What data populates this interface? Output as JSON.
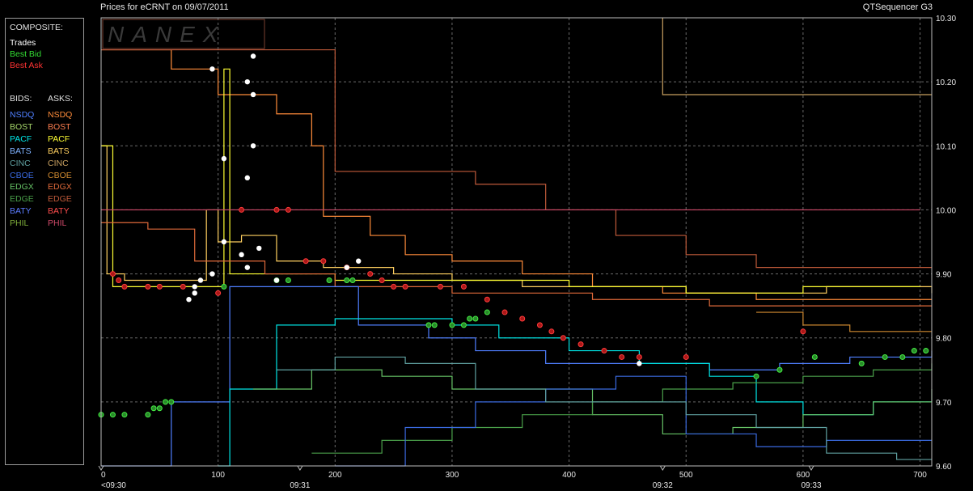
{
  "header": {
    "title": "Prices for  eCRNT  on  09/07/2011",
    "brand": "QTSequencer G3"
  },
  "watermark": "NANEX",
  "legend": {
    "composite_label": "COMPOSITE:",
    "composite": [
      {
        "label": "Trades",
        "color": "#ffffff"
      },
      {
        "label": "Best Bid",
        "color": "#33dd33"
      },
      {
        "label": "Best Ask",
        "color": "#ff3333"
      }
    ],
    "bids_label": "BIDS:",
    "asks_label": "ASKS:",
    "exchanges": [
      {
        "bid": "NSDQ",
        "ask": "NSDQ",
        "bid_color": "#4f7fff",
        "ask_color": "#ff8c3a"
      },
      {
        "bid": "BOST",
        "ask": "BOST",
        "bid_color": "#a7d86b",
        "ask_color": "#ff7f50"
      },
      {
        "bid": "PACF",
        "ask": "PACF",
        "bid_color": "#00e5e5",
        "ask_color": "#ffff33"
      },
      {
        "bid": "BATS",
        "ask": "BATS",
        "bid_color": "#7fb2ff",
        "ask_color": "#ffd060"
      },
      {
        "bid": "CINC",
        "ask": "CINC",
        "bid_color": "#5fa0a0",
        "ask_color": "#c8a060"
      },
      {
        "bid": "CBOE",
        "ask": "CBOE",
        "bid_color": "#3a6ae0",
        "ask_color": "#d08a30"
      },
      {
        "bid": "EDGX",
        "ask": "EDGX",
        "bid_color": "#66c266",
        "ask_color": "#e06a3a"
      },
      {
        "bid": "EDGE",
        "ask": "EDGE",
        "bid_color": "#4aa04a",
        "ask_color": "#c05a3a"
      },
      {
        "bid": "BATY",
        "ask": "BATY",
        "bid_color": "#5b7cff",
        "ask_color": "#ff4d4d"
      },
      {
        "bid": "PHIL",
        "ask": "PHIL",
        "bid_color": "#7fae3a",
        "ask_color": "#d04a6a"
      }
    ]
  },
  "chart_data": {
    "type": "line",
    "x_ticks": [
      0,
      100,
      200,
      300,
      400,
      500,
      600,
      700
    ],
    "x_time_labels": [
      {
        "x": 0,
        "label": "<09:30"
      },
      {
        "x": 170,
        "label": "09:31"
      },
      {
        "x": 480,
        "label": "09:32"
      },
      {
        "x": 607,
        "label": "09:33"
      }
    ],
    "xlim": [
      0,
      710
    ],
    "y_ticks": [
      "10.30",
      "10.20",
      "10.10",
      "10.00",
      "9.90",
      "9.80",
      "9.70",
      "9.60"
    ],
    "ylim": [
      9.6,
      10.3
    ],
    "grid": true,
    "series": [
      {
        "color": "#ff8c3a",
        "points": [
          [
            0,
            10.25
          ],
          [
            40,
            10.25
          ],
          [
            60,
            10.22
          ],
          [
            100,
            10.18
          ],
          [
            150,
            10.15
          ],
          [
            180,
            10.1
          ],
          [
            190,
            9.99
          ],
          [
            230,
            9.96
          ],
          [
            260,
            9.93
          ],
          [
            300,
            9.92
          ],
          [
            360,
            9.9
          ],
          [
            420,
            9.88
          ],
          [
            480,
            9.87
          ],
          [
            560,
            9.86
          ],
          [
            640,
            9.86
          ],
          [
            710,
            9.86
          ]
        ]
      },
      {
        "color": "#ffd060",
        "points": [
          [
            0,
            10.1
          ],
          [
            5,
            9.9
          ],
          [
            20,
            9.89
          ],
          [
            60,
            9.89
          ],
          [
            90,
            10.0
          ],
          [
            100,
            9.95
          ],
          [
            120,
            9.96
          ],
          [
            150,
            9.92
          ],
          [
            190,
            9.91
          ],
          [
            250,
            9.9
          ],
          [
            300,
            9.89
          ],
          [
            360,
            9.88
          ],
          [
            400,
            9.88
          ],
          [
            440,
            9.88
          ],
          [
            500,
            9.87
          ],
          [
            560,
            9.87
          ],
          [
            620,
            9.88
          ],
          [
            680,
            9.88
          ],
          [
            710,
            9.87
          ]
        ]
      },
      {
        "color": "#ffff33",
        "points": [
          [
            0,
            10.1
          ],
          [
            10,
            9.88
          ],
          [
            100,
            9.88
          ],
          [
            105,
            10.22
          ],
          [
            110,
            9.9
          ],
          [
            200,
            9.89
          ],
          [
            300,
            9.89
          ],
          [
            400,
            9.88
          ],
          [
            500,
            9.87
          ],
          [
            600,
            9.88
          ],
          [
            700,
            9.88
          ]
        ]
      },
      {
        "color": "#c05a3a",
        "points": [
          [
            0,
            10.25
          ],
          [
            200,
            10.25
          ],
          [
            200,
            10.06
          ],
          [
            270,
            10.06
          ],
          [
            320,
            10.04
          ],
          [
            380,
            10.0
          ],
          [
            440,
            9.96
          ],
          [
            500,
            9.93
          ],
          [
            560,
            9.91
          ],
          [
            640,
            9.91
          ],
          [
            710,
            9.91
          ]
        ]
      },
      {
        "color": "#d04a6a",
        "points": [
          [
            0,
            10.0
          ],
          [
            300,
            10.0
          ],
          [
            500,
            10.0
          ],
          [
            700,
            10.0
          ]
        ]
      },
      {
        "color": "#e06a3a",
        "points": [
          [
            0,
            9.98
          ],
          [
            40,
            9.97
          ],
          [
            80,
            9.92
          ],
          [
            140,
            9.9
          ],
          [
            200,
            9.88
          ],
          [
            300,
            9.87
          ],
          [
            420,
            9.86
          ],
          [
            520,
            9.85
          ],
          [
            620,
            9.85
          ],
          [
            710,
            9.85
          ]
        ]
      },
      {
        "color": "#c8a060",
        "points": [
          [
            480,
            10.3
          ],
          [
            480,
            10.18
          ],
          [
            710,
            10.18
          ]
        ]
      },
      {
        "color": "#d08a30",
        "points": [
          [
            560,
            9.84
          ],
          [
            600,
            9.82
          ],
          [
            640,
            9.81
          ],
          [
            710,
            9.81
          ]
        ]
      },
      {
        "color": "#4f7fff",
        "points": [
          [
            0,
            9.6
          ],
          [
            60,
            9.7
          ],
          [
            100,
            9.7
          ],
          [
            110,
            9.88
          ],
          [
            180,
            9.88
          ],
          [
            220,
            9.82
          ],
          [
            280,
            9.8
          ],
          [
            320,
            9.78
          ],
          [
            380,
            9.76
          ],
          [
            440,
            9.76
          ],
          [
            520,
            9.75
          ],
          [
            580,
            9.76
          ],
          [
            640,
            9.77
          ],
          [
            710,
            9.78
          ]
        ]
      },
      {
        "color": "#00e5e5",
        "points": [
          [
            100,
            9.6
          ],
          [
            110,
            9.72
          ],
          [
            150,
            9.82
          ],
          [
            200,
            9.83
          ],
          [
            260,
            9.83
          ],
          [
            300,
            9.82
          ],
          [
            340,
            9.8
          ],
          [
            400,
            9.78
          ],
          [
            460,
            9.76
          ],
          [
            520,
            9.74
          ],
          [
            560,
            9.7
          ],
          [
            600,
            9.68
          ],
          [
            660,
            9.7
          ],
          [
            710,
            9.7
          ]
        ]
      },
      {
        "color": "#66c266",
        "points": [
          [
            130,
            9.72
          ],
          [
            180,
            9.75
          ],
          [
            240,
            9.74
          ],
          [
            300,
            9.72
          ],
          [
            360,
            9.72
          ],
          [
            420,
            9.68
          ],
          [
            480,
            9.65
          ],
          [
            540,
            9.66
          ],
          [
            600,
            9.68
          ],
          [
            660,
            9.7
          ],
          [
            710,
            9.72
          ]
        ]
      },
      {
        "color": "#4aa04a",
        "points": [
          [
            180,
            9.62
          ],
          [
            240,
            9.64
          ],
          [
            300,
            9.66
          ],
          [
            360,
            9.68
          ],
          [
            420,
            9.7
          ],
          [
            480,
            9.72
          ],
          [
            540,
            9.73
          ],
          [
            600,
            9.74
          ],
          [
            660,
            9.75
          ],
          [
            710,
            9.76
          ]
        ]
      },
      {
        "color": "#3a6ae0",
        "points": [
          [
            200,
            9.6
          ],
          [
            260,
            9.66
          ],
          [
            320,
            9.7
          ],
          [
            380,
            9.72
          ],
          [
            440,
            9.74
          ],
          [
            500,
            9.65
          ],
          [
            560,
            9.63
          ],
          [
            620,
            9.64
          ],
          [
            680,
            9.64
          ],
          [
            710,
            9.64
          ]
        ]
      },
      {
        "color": "#5fa0a0",
        "points": [
          [
            150,
            9.75
          ],
          [
            200,
            9.77
          ],
          [
            260,
            9.76
          ],
          [
            320,
            9.72
          ],
          [
            380,
            9.7
          ],
          [
            440,
            9.7
          ],
          [
            500,
            9.68
          ],
          [
            560,
            9.66
          ],
          [
            620,
            9.62
          ],
          [
            680,
            9.61
          ],
          [
            710,
            9.61
          ]
        ]
      }
    ],
    "best_bid": [
      [
        0,
        9.68
      ],
      [
        10,
        9.68
      ],
      [
        20,
        9.68
      ],
      [
        40,
        9.68
      ],
      [
        45,
        9.69
      ],
      [
        50,
        9.69
      ],
      [
        55,
        9.7
      ],
      [
        60,
        9.7
      ],
      [
        105,
        9.88
      ],
      [
        150,
        9.89
      ],
      [
        160,
        9.89
      ],
      [
        195,
        9.89
      ],
      [
        210,
        9.89
      ],
      [
        215,
        9.89
      ],
      [
        280,
        9.82
      ],
      [
        285,
        9.82
      ],
      [
        300,
        9.82
      ],
      [
        310,
        9.82
      ],
      [
        315,
        9.83
      ],
      [
        320,
        9.83
      ],
      [
        330,
        9.84
      ],
      [
        560,
        9.74
      ],
      [
        580,
        9.75
      ],
      [
        610,
        9.77
      ],
      [
        650,
        9.76
      ],
      [
        670,
        9.77
      ],
      [
        685,
        9.77
      ],
      [
        695,
        9.78
      ],
      [
        705,
        9.78
      ]
    ],
    "best_ask": [
      [
        10,
        9.9
      ],
      [
        15,
        9.89
      ],
      [
        20,
        9.88
      ],
      [
        40,
        9.88
      ],
      [
        50,
        9.88
      ],
      [
        70,
        9.88
      ],
      [
        100,
        9.87
      ],
      [
        120,
        10.0
      ],
      [
        150,
        10.0
      ],
      [
        160,
        10.0
      ],
      [
        175,
        9.92
      ],
      [
        190,
        9.92
      ],
      [
        210,
        9.91
      ],
      [
        230,
        9.9
      ],
      [
        240,
        9.89
      ],
      [
        250,
        9.88
      ],
      [
        260,
        9.88
      ],
      [
        290,
        9.88
      ],
      [
        310,
        9.88
      ],
      [
        330,
        9.86
      ],
      [
        345,
        9.84
      ],
      [
        360,
        9.83
      ],
      [
        375,
        9.82
      ],
      [
        385,
        9.81
      ],
      [
        395,
        9.8
      ],
      [
        410,
        9.79
      ],
      [
        430,
        9.78
      ],
      [
        445,
        9.77
      ],
      [
        460,
        9.77
      ],
      [
        500,
        9.77
      ],
      [
        600,
        9.81
      ]
    ],
    "trades": [
      [
        130,
        10.24
      ],
      [
        95,
        10.22
      ],
      [
        125,
        10.2
      ],
      [
        130,
        10.18
      ],
      [
        130,
        10.1
      ],
      [
        105,
        10.08
      ],
      [
        125,
        10.05
      ],
      [
        105,
        9.95
      ],
      [
        135,
        9.94
      ],
      [
        120,
        9.93
      ],
      [
        125,
        9.91
      ],
      [
        95,
        9.9
      ],
      [
        85,
        9.89
      ],
      [
        80,
        9.88
      ],
      [
        80,
        9.87
      ],
      [
        75,
        9.86
      ],
      [
        150,
        9.89
      ],
      [
        460,
        9.76
      ],
      [
        210,
        9.91
      ],
      [
        220,
        9.92
      ]
    ]
  }
}
